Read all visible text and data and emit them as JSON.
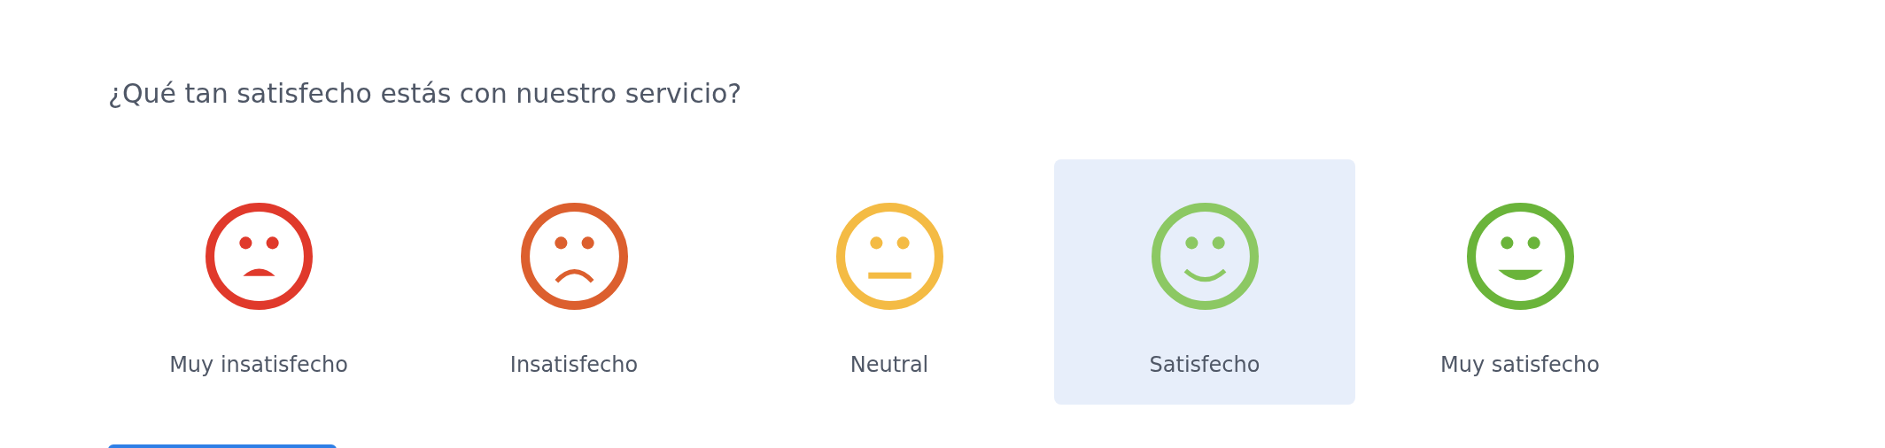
{
  "question": "¿Qué tan satisfecho estás con nuestro servicio?",
  "options": [
    {
      "label": "Muy insatisfecho",
      "kind": "very_sad",
      "color": "#e0392b",
      "selected": false
    },
    {
      "label": "Insatisfecho",
      "kind": "sad",
      "color": "#dc5f2e",
      "selected": false
    },
    {
      "label": "Neutral",
      "kind": "neutral",
      "color": "#f4bb44",
      "selected": false
    },
    {
      "label": "Satisfecho",
      "kind": "happy",
      "color": "#8cc863",
      "selected": true
    },
    {
      "label": "Muy satisfecho",
      "kind": "very_happy",
      "color": "#6ab43a",
      "selected": false
    }
  ]
}
